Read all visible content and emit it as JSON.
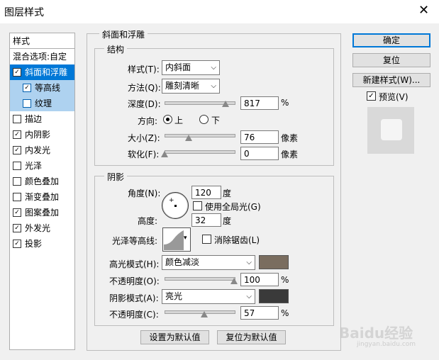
{
  "window": {
    "title": "图层样式",
    "close_glyph": "✕"
  },
  "sidebar": {
    "items": [
      {
        "label": "样式",
        "checkbox": false,
        "checked": false,
        "state": "header"
      },
      {
        "label": "混合选项:自定",
        "checkbox": false,
        "checked": false,
        "state": "normal"
      },
      {
        "label": "斜面和浮雕",
        "checkbox": true,
        "checked": true,
        "state": "selected"
      },
      {
        "label": "等高线",
        "checkbox": true,
        "checked": true,
        "state": "sub"
      },
      {
        "label": "纹理",
        "checkbox": true,
        "checked": false,
        "state": "sub"
      },
      {
        "label": "描边",
        "checkbox": true,
        "checked": false,
        "state": "normal"
      },
      {
        "label": "内阴影",
        "checkbox": true,
        "checked": true,
        "state": "normal"
      },
      {
        "label": "内发光",
        "checkbox": true,
        "checked": true,
        "state": "normal"
      },
      {
        "label": "光泽",
        "checkbox": true,
        "checked": false,
        "state": "normal"
      },
      {
        "label": "颜色叠加",
        "checkbox": true,
        "checked": false,
        "state": "normal"
      },
      {
        "label": "渐变叠加",
        "checkbox": true,
        "checked": false,
        "state": "normal"
      },
      {
        "label": "图案叠加",
        "checkbox": true,
        "checked": true,
        "state": "normal"
      },
      {
        "label": "外发光",
        "checkbox": true,
        "checked": true,
        "state": "normal"
      },
      {
        "label": "投影",
        "checkbox": true,
        "checked": true,
        "state": "normal"
      }
    ],
    "check_glyph": "✓"
  },
  "bevel": {
    "section_title": "斜面和浮雕",
    "structure_title": "结构",
    "style_label": "样式(T):",
    "style_value": "内斜面",
    "technique_label": "方法(Q):",
    "technique_value": "雕刻清晰",
    "depth_label": "深度(D):",
    "depth_value": "817",
    "depth_unit": "%",
    "depth_slider": 0.88,
    "direction_label": "方向:",
    "direction_up": "上",
    "direction_down": "下",
    "direction_selected": "上",
    "size_label": "大小(Z):",
    "size_value": "76",
    "size_unit": "像素",
    "size_slider": 0.35,
    "soften_label": "软化(F):",
    "soften_value": "0",
    "soften_unit": "像素",
    "soften_slider": 0.0
  },
  "shading": {
    "title": "阴影",
    "angle_label": "角度(N):",
    "angle_value": "120",
    "angle_unit": "度",
    "global_light_label": "使用全局光(G)",
    "global_light_checked": false,
    "altitude_label": "高度:",
    "altitude_value": "32",
    "altitude_unit": "度",
    "gloss_label": "光泽等高线:",
    "antialias_label": "消除锯齿(L)",
    "antialias_checked": false,
    "highlight_mode_label": "高光模式(H):",
    "highlight_mode_value": "颜色减淡",
    "highlight_color": "#7a6d5f",
    "highlight_opacity_label": "不透明度(O):",
    "highlight_opacity_value": "100",
    "highlight_opacity_unit": "%",
    "highlight_opacity_slider": 1.0,
    "shadow_mode_label": "阴影模式(A):",
    "shadow_mode_value": "亮光",
    "shadow_color": "#3a3a3a",
    "shadow_opacity_label": "不透明度(C):",
    "shadow_opacity_value": "57",
    "shadow_opacity_unit": "%",
    "shadow_opacity_slider": 0.57
  },
  "footer": {
    "make_default": "设置为默认值",
    "reset_default": "复位为默认值"
  },
  "actions": {
    "ok": "确定",
    "reset": "复位",
    "new_style": "新建样式(W)...",
    "preview_label": "预览(V)",
    "preview_checked": true
  },
  "watermark": {
    "text": "Baidu经验",
    "sub": "jingyan.baidu.com"
  },
  "icons": {
    "dropdown": "chevron-down-icon",
    "close": "close-icon",
    "check": "checkmark-icon"
  }
}
